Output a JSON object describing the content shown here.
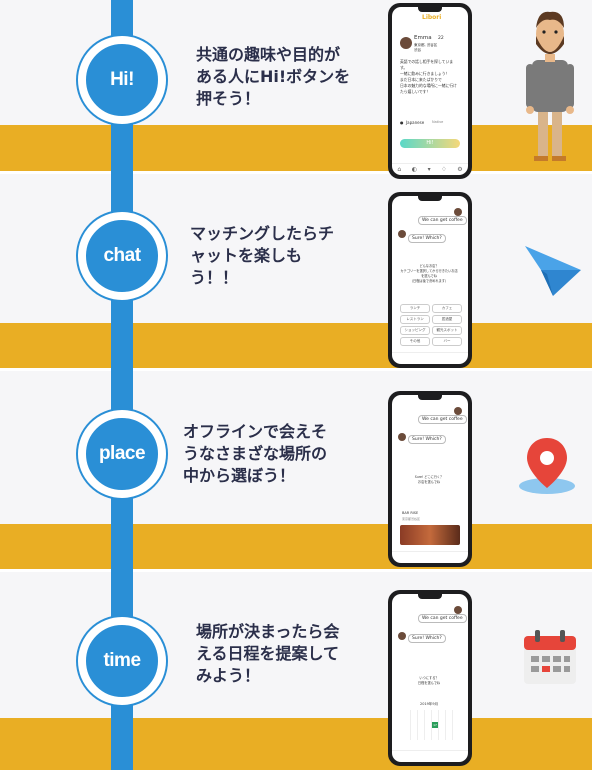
{
  "steps": [
    {
      "node": "Hi!",
      "text": "共通の趣味や目的が\nある人にHi!ボタンを\n押そう！"
    },
    {
      "node": "chat",
      "text": "マッチングしたらチ\nャットを楽しも\nう！！"
    },
    {
      "node": "place",
      "text": "オフラインで会えそ\nうなさまざな場所の\n中から選ぼう！"
    },
    {
      "node": "time",
      "text": "場所が決まったら会\nえる日程を提案して\nみよう！"
    }
  ],
  "phone1": {
    "app_title": "Libori",
    "user_name": "Emma",
    "user_age": "22",
    "user_loc": "東京都, 渋谷区",
    "user_sub": "渋谷",
    "bio": "英語での話し相手を探しています。\n一緒に飲みに行きましょう！\nまだ日本に来たばかりで\n日本の魅力的な場所に一緒に行けたら嬉しいです！",
    "lang1": "Japanese",
    "lang2": "Native",
    "hi_button": "Hi!"
  },
  "chat": {
    "msg_out": "We can get coffee",
    "msg_in": "Sure! Which?",
    "prompt": "どんなお店？\nカテゴリーを選択してから行きたいお店を選んでね\n（日程は後で決めれます）",
    "chips": [
      "カフェ",
      "バー",
      "レストラン",
      "居酒屋",
      "ショッピング",
      "観光スポット",
      "ランチ",
      "その他"
    ]
  },
  "place": {
    "prompt": "Sure! どこに行く？\nお店を選んでね",
    "shop_name": "BAR RISE",
    "shop_info": "東京都渋谷区"
  },
  "time": {
    "prompt": "いつにする？\n日程を選んでね",
    "month": "2019年9月",
    "highlight_day": "17"
  },
  "colors": {
    "band": "#e9ae24",
    "timeline": "#2a8fd6",
    "text": "#2b2f4a"
  }
}
